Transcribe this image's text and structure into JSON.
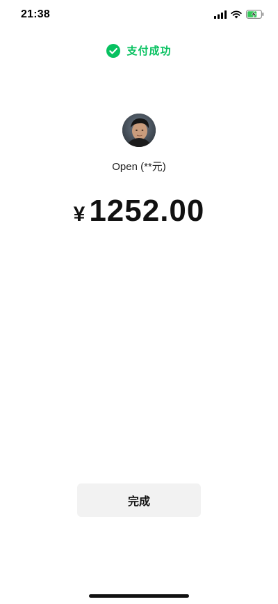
{
  "status_bar": {
    "time": "21:38",
    "icons": [
      "signal-icon",
      "wifi-icon",
      "battery-charging-icon"
    ]
  },
  "payment": {
    "status_text": "支付成功",
    "status_icon": "check-circle-icon",
    "status_color": "#07c160",
    "payee": "Open (**元)",
    "currency_symbol": "¥",
    "amount": "1252.00"
  },
  "actions": {
    "done_label": "完成"
  }
}
